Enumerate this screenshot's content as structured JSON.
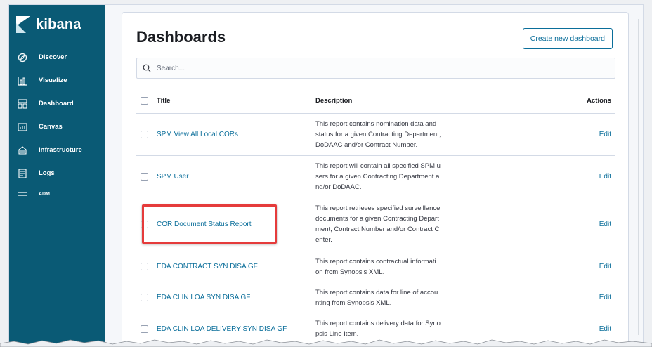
{
  "app": {
    "logo_text": "kibana"
  },
  "sidebar": {
    "items": [
      {
        "label": "Discover",
        "icon": "compass-icon"
      },
      {
        "label": "Visualize",
        "icon": "visualize-icon"
      },
      {
        "label": "Dashboard",
        "icon": "dashboard-icon"
      },
      {
        "label": "Canvas",
        "icon": "canvas-icon"
      },
      {
        "label": "Infrastructure",
        "icon": "infrastructure-icon"
      },
      {
        "label": "Logs",
        "icon": "logs-icon"
      },
      {
        "label": "ADM",
        "icon": "menu-icon"
      }
    ]
  },
  "page": {
    "title": "Dashboards",
    "create_button": "Create new dashboard",
    "search_placeholder": "Search..."
  },
  "table": {
    "headers": {
      "title": "Title",
      "description": "Description",
      "actions": "Actions"
    },
    "rows": [
      {
        "title": "SPM View All Local CORs",
        "description": [
          "This report contains nomination data and",
          "status for a given Contracting Department,",
          "DoDAAC and/or Contract Number."
        ],
        "action": "Edit"
      },
      {
        "title": "SPM User",
        "description": [
          "This report will contain all specified SPM u",
          "sers for a given Contracting Department a",
          "nd/or DoDAAC."
        ],
        "action": "Edit"
      },
      {
        "title": "COR Document Status Report",
        "description": [
          "This report retrieves specified surveillance",
          "documents for a given Contracting Depart",
          "ment, Contract Number and/or Contract C",
          "enter."
        ],
        "action": "Edit",
        "highlighted": true
      },
      {
        "title": "EDA CONTRACT SYN DISA GF",
        "description": [
          "This report contains contractual informati",
          "on from Synopsis XML."
        ],
        "action": "Edit"
      },
      {
        "title": "EDA CLIN LOA SYN DISA GF",
        "description": [
          "This report contains data for line of accou",
          "nting from Synopsis XML."
        ],
        "action": "Edit"
      },
      {
        "title": "EDA CLIN LOA DELIVERY SYN DISA GF",
        "description": [
          "This report contains delivery data for Syno",
          "psis Line Item."
        ],
        "action": "Edit"
      }
    ]
  },
  "colors": {
    "sidebar": "#0a5a75",
    "link": "#0a6e9a",
    "highlight": "#e53b3b"
  }
}
